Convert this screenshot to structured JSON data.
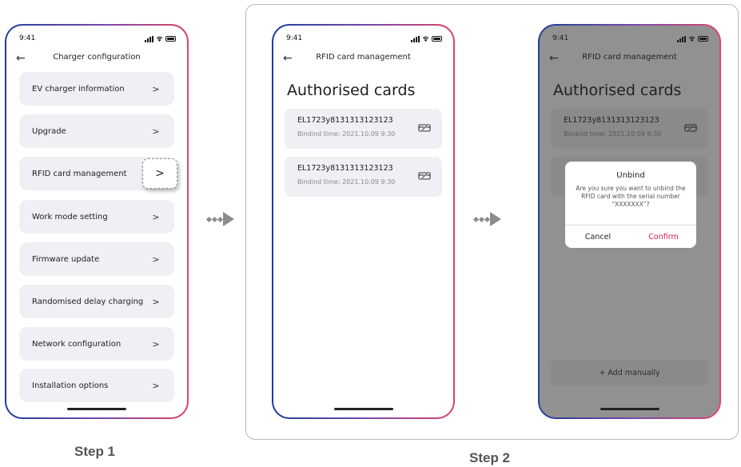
{
  "status_bar": {
    "time": "9:41"
  },
  "screen1": {
    "nav_title": "Charger configuration",
    "items": [
      {
        "label": "EV charger information"
      },
      {
        "label": "Upgrade"
      },
      {
        "label": "RFID card management"
      },
      {
        "label": "Work mode setting"
      },
      {
        "label": "Firmware update"
      },
      {
        "label": "Randomised delay charging"
      },
      {
        "label": "Network configuration"
      },
      {
        "label": "Installation options"
      }
    ]
  },
  "screen2": {
    "nav_title": "RFID card management",
    "heading": "Authorised cards",
    "cards": [
      {
        "serial": "EL1723y8131313123123",
        "bind_time": "Bindind time: 2021.10.09 9:30"
      },
      {
        "serial": "EL1723y8131313123123",
        "bind_time": "Bindind time: 2021.10.09 9:30"
      }
    ]
  },
  "screen3": {
    "nav_title": "RFID card management",
    "heading": "Authorised cards",
    "card": {
      "serial": "EL1723y8131313123123",
      "bind_time": "Bindind time: 2021.10.09 9:30"
    },
    "add_label": "+ Add manually",
    "dialog": {
      "title": "Unbind",
      "message": "Are you sure you want to unbind the RFID card with the serial number “XXXXXXX”?",
      "cancel": "Cancel",
      "confirm": "Confirm"
    }
  },
  "labels": {
    "step1": "Step 1",
    "step2": "Step 2"
  },
  "icons": {
    "back": "back-arrow-icon",
    "chevron": "chevron-right-icon",
    "unbind": "unlink-card-icon"
  },
  "colors": {
    "accent": "#d4214f",
    "frame_start": "#1e3f9a",
    "frame_end": "#e0436b"
  }
}
